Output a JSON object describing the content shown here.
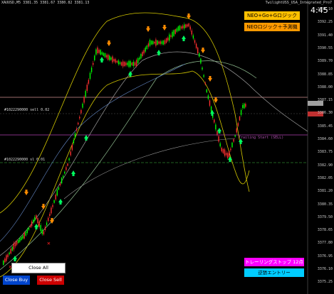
{
  "header": {
    "symbol_info": "XAUUSD,M5  3381.35 3381.67 3380.82 3381.13",
    "window_info": "TwilightUSS_USA_Integrated_Pro7"
  },
  "clock": "4:45",
  "buttons_top": {
    "logic1": "NEO+Go+Gロジック",
    "logic2": "NEOロジック＋予測機能"
  },
  "lines": {
    "sell_line_label": "#1022290000 sell 0.02",
    "trailing_label": "Trailing Start (SELL)",
    "sl_label": "#1022290000 sl 0.01"
  },
  "price_axis": [
    "3393.10",
    "3392.25",
    "3391.40",
    "3390.55",
    "3389.70",
    "3388.85",
    "3388.00",
    "3387.15",
    "3386.30",
    "3385.45",
    "3384.60",
    "3383.75",
    "3382.90",
    "3382.05",
    "3381.20",
    "3380.35",
    "3379.50",
    "3378.65",
    "3377.80",
    "3376.95",
    "3376.10",
    "3375.25"
  ],
  "buttons_bottom": {
    "close_all": "Close All",
    "close_buy": "Close Buy",
    "close_sell": "Close Sell",
    "trail_stop": "トレーリングストップ 12点",
    "entry": "逆張エントリー"
  },
  "colors": {
    "magenta_btn": "#ff00ff",
    "cyan_btn": "#00ccff",
    "buy_btn": "#0044cc",
    "sell_btn": "#cc0000",
    "bull": "#00ff00",
    "bear": "#ff3030"
  },
  "icons": [
    "buy-arrow-icon",
    "sell-arrow-icon",
    "cross-icon"
  ]
}
